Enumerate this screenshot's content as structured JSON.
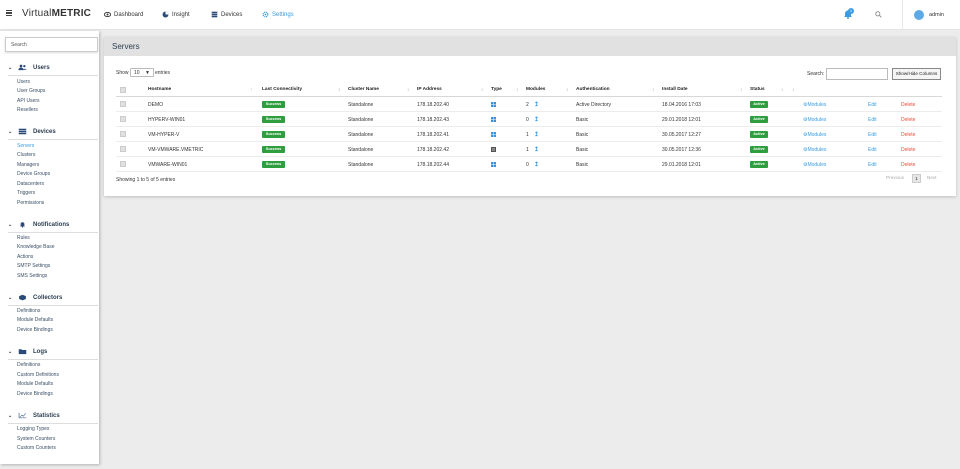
{
  "app": {
    "brand_light": "Virtual",
    "brand_bold": "METRIC"
  },
  "nav": [
    {
      "label": "Dashboard",
      "icon": "eye-icon"
    },
    {
      "label": "Insight",
      "icon": "chart-icon"
    },
    {
      "label": "Devices",
      "icon": "server-icon"
    },
    {
      "label": "Settings",
      "icon": "gear-icon"
    }
  ],
  "top": {
    "notifications": "1",
    "user": "admin"
  },
  "sidebar": {
    "search_placeholder": "Search",
    "sections": [
      {
        "title": "Users",
        "icon": "users-icon",
        "items": [
          "Users",
          "User Groups",
          "API Users",
          "Resellers"
        ]
      },
      {
        "title": "Devices",
        "icon": "server-icon",
        "items": [
          "Servers",
          "Clusters",
          "Managers",
          "Device Groups",
          "Datacenters",
          "Triggers",
          "Permissions"
        ]
      },
      {
        "title": "Notifications",
        "icon": "bell-icon",
        "items": [
          "Rules",
          "Knowledge Base",
          "Actions",
          "SMTP Settings",
          "SMS Settings"
        ]
      },
      {
        "title": "Collectors",
        "icon": "box-icon",
        "items": [
          "Definitions",
          "Module Defaults",
          "Device Bindings"
        ]
      },
      {
        "title": "Logs",
        "icon": "folder-icon",
        "items": [
          "Definitions",
          "Custom Definitions",
          "Module Defaults",
          "Device Bindings"
        ]
      },
      {
        "title": "Statistics",
        "icon": "chart-icon",
        "items": [
          "Logging Types",
          "System Counters",
          "Custom Counters"
        ]
      }
    ]
  },
  "main": {
    "title": "Servers",
    "show_label": "Show",
    "page_size": "10",
    "entries_label": "entries",
    "search_label": "Search:",
    "show_hide_label": "Show/Hide Columns",
    "columns": [
      "Hostname",
      "Last Connectivity",
      "Cluster Name",
      "IP Address",
      "Type",
      "Modules",
      "Authentication",
      "Install Date",
      "Status"
    ],
    "rows": [
      {
        "hostname": "DEMO",
        "connectivity": "Success",
        "cluster": "Standalone",
        "ip": "178.18.202.40",
        "os": "windows",
        "modules": "2",
        "auth": "Active Directory",
        "install": "18.04.2016 17:03",
        "status": "Active",
        "modules_link": "Modules",
        "edit": "Edit",
        "delete": "Delete"
      },
      {
        "hostname": "HYPERV-WIN01",
        "connectivity": "Success",
        "cluster": "Standalone",
        "ip": "178.18.202.43",
        "os": "windows",
        "modules": "0",
        "auth": "Basic",
        "install": "29.01.2018 12:01",
        "status": "Active",
        "modules_link": "Modules",
        "edit": "Edit",
        "delete": "Delete"
      },
      {
        "hostname": "VM-HYPER-V",
        "connectivity": "Success",
        "cluster": "Standalone",
        "ip": "178.18.202.41",
        "os": "windows",
        "modules": "1",
        "auth": "Basic",
        "install": "30.05.2017 12:27",
        "status": "Active",
        "modules_link": "Modules",
        "edit": "Edit",
        "delete": "Delete"
      },
      {
        "hostname": "VM-VMWARE.VMETRIC",
        "connectivity": "Success",
        "cluster": "Standalone",
        "ip": "178.18.202.42",
        "os": "vmware",
        "modules": "1",
        "auth": "Basic",
        "install": "30.05.2017 12:36",
        "status": "Active",
        "modules_link": "Modules",
        "edit": "Edit",
        "delete": "Delete"
      },
      {
        "hostname": "VMWARE-WIN01",
        "connectivity": "Success",
        "cluster": "Standalone",
        "ip": "178.18.202.44",
        "os": "windows",
        "modules": "0",
        "auth": "Basic",
        "install": "29.01.2018 12:01",
        "status": "Active",
        "modules_link": "Modules",
        "edit": "Edit",
        "delete": "Delete"
      }
    ],
    "info": "Showing 1 to 5 of 5 entries",
    "pagination": {
      "previous": "Previous",
      "current": "1",
      "next": "Next"
    }
  },
  "colors": {
    "accent": "#3b9ce0",
    "success": "#2e9e3e",
    "danger": "#e74c3c",
    "panel_header": "#e1e1e1"
  }
}
